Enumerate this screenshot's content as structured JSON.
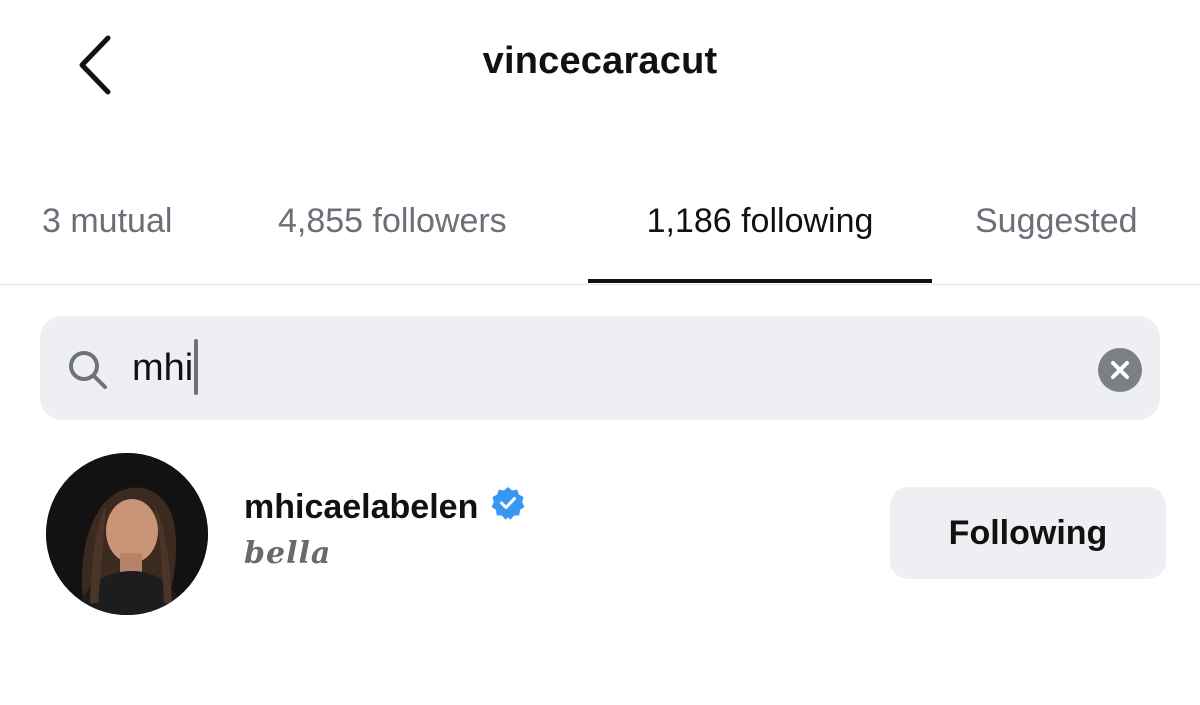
{
  "header": {
    "title": "vincecaracut",
    "back_icon": "chevron-left-icon"
  },
  "tabs": [
    {
      "label": "3 mutual",
      "active": false
    },
    {
      "label": "4,855 followers",
      "active": false
    },
    {
      "label": "1,186 following",
      "active": true
    },
    {
      "label": "Suggested",
      "active": false
    }
  ],
  "search": {
    "value": "mhi",
    "icon": "search-icon",
    "clear_icon": "clear-icon"
  },
  "results": [
    {
      "username": "mhicaelabelen",
      "verified": true,
      "bio": "bella",
      "button_label": "Following"
    }
  ],
  "colors": {
    "verified": "#3897f0",
    "tab_inactive": "#6b6f77",
    "search_bg": "#eeeff2",
    "button_bg": "#eeeff2"
  }
}
